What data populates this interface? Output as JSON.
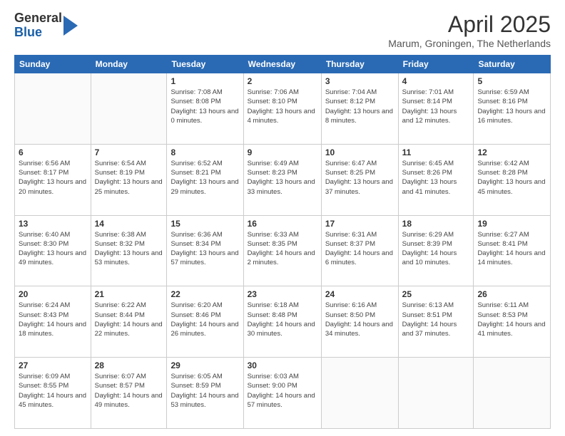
{
  "logo": {
    "general": "General",
    "blue": "Blue"
  },
  "header": {
    "month": "April 2025",
    "location": "Marum, Groningen, The Netherlands"
  },
  "weekdays": [
    "Sunday",
    "Monday",
    "Tuesday",
    "Wednesday",
    "Thursday",
    "Friday",
    "Saturday"
  ],
  "weeks": [
    [
      {
        "day": "",
        "info": ""
      },
      {
        "day": "",
        "info": ""
      },
      {
        "day": "1",
        "info": "Sunrise: 7:08 AM\nSunset: 8:08 PM\nDaylight: 13 hours and 0 minutes."
      },
      {
        "day": "2",
        "info": "Sunrise: 7:06 AM\nSunset: 8:10 PM\nDaylight: 13 hours and 4 minutes."
      },
      {
        "day": "3",
        "info": "Sunrise: 7:04 AM\nSunset: 8:12 PM\nDaylight: 13 hours and 8 minutes."
      },
      {
        "day": "4",
        "info": "Sunrise: 7:01 AM\nSunset: 8:14 PM\nDaylight: 13 hours and 12 minutes."
      },
      {
        "day": "5",
        "info": "Sunrise: 6:59 AM\nSunset: 8:16 PM\nDaylight: 13 hours and 16 minutes."
      }
    ],
    [
      {
        "day": "6",
        "info": "Sunrise: 6:56 AM\nSunset: 8:17 PM\nDaylight: 13 hours and 20 minutes."
      },
      {
        "day": "7",
        "info": "Sunrise: 6:54 AM\nSunset: 8:19 PM\nDaylight: 13 hours and 25 minutes."
      },
      {
        "day": "8",
        "info": "Sunrise: 6:52 AM\nSunset: 8:21 PM\nDaylight: 13 hours and 29 minutes."
      },
      {
        "day": "9",
        "info": "Sunrise: 6:49 AM\nSunset: 8:23 PM\nDaylight: 13 hours and 33 minutes."
      },
      {
        "day": "10",
        "info": "Sunrise: 6:47 AM\nSunset: 8:25 PM\nDaylight: 13 hours and 37 minutes."
      },
      {
        "day": "11",
        "info": "Sunrise: 6:45 AM\nSunset: 8:26 PM\nDaylight: 13 hours and 41 minutes."
      },
      {
        "day": "12",
        "info": "Sunrise: 6:42 AM\nSunset: 8:28 PM\nDaylight: 13 hours and 45 minutes."
      }
    ],
    [
      {
        "day": "13",
        "info": "Sunrise: 6:40 AM\nSunset: 8:30 PM\nDaylight: 13 hours and 49 minutes."
      },
      {
        "day": "14",
        "info": "Sunrise: 6:38 AM\nSunset: 8:32 PM\nDaylight: 13 hours and 53 minutes."
      },
      {
        "day": "15",
        "info": "Sunrise: 6:36 AM\nSunset: 8:34 PM\nDaylight: 13 hours and 57 minutes."
      },
      {
        "day": "16",
        "info": "Sunrise: 6:33 AM\nSunset: 8:35 PM\nDaylight: 14 hours and 2 minutes."
      },
      {
        "day": "17",
        "info": "Sunrise: 6:31 AM\nSunset: 8:37 PM\nDaylight: 14 hours and 6 minutes."
      },
      {
        "day": "18",
        "info": "Sunrise: 6:29 AM\nSunset: 8:39 PM\nDaylight: 14 hours and 10 minutes."
      },
      {
        "day": "19",
        "info": "Sunrise: 6:27 AM\nSunset: 8:41 PM\nDaylight: 14 hours and 14 minutes."
      }
    ],
    [
      {
        "day": "20",
        "info": "Sunrise: 6:24 AM\nSunset: 8:43 PM\nDaylight: 14 hours and 18 minutes."
      },
      {
        "day": "21",
        "info": "Sunrise: 6:22 AM\nSunset: 8:44 PM\nDaylight: 14 hours and 22 minutes."
      },
      {
        "day": "22",
        "info": "Sunrise: 6:20 AM\nSunset: 8:46 PM\nDaylight: 14 hours and 26 minutes."
      },
      {
        "day": "23",
        "info": "Sunrise: 6:18 AM\nSunset: 8:48 PM\nDaylight: 14 hours and 30 minutes."
      },
      {
        "day": "24",
        "info": "Sunrise: 6:16 AM\nSunset: 8:50 PM\nDaylight: 14 hours and 34 minutes."
      },
      {
        "day": "25",
        "info": "Sunrise: 6:13 AM\nSunset: 8:51 PM\nDaylight: 14 hours and 37 minutes."
      },
      {
        "day": "26",
        "info": "Sunrise: 6:11 AM\nSunset: 8:53 PM\nDaylight: 14 hours and 41 minutes."
      }
    ],
    [
      {
        "day": "27",
        "info": "Sunrise: 6:09 AM\nSunset: 8:55 PM\nDaylight: 14 hours and 45 minutes."
      },
      {
        "day": "28",
        "info": "Sunrise: 6:07 AM\nSunset: 8:57 PM\nDaylight: 14 hours and 49 minutes."
      },
      {
        "day": "29",
        "info": "Sunrise: 6:05 AM\nSunset: 8:59 PM\nDaylight: 14 hours and 53 minutes."
      },
      {
        "day": "30",
        "info": "Sunrise: 6:03 AM\nSunset: 9:00 PM\nDaylight: 14 hours and 57 minutes."
      },
      {
        "day": "",
        "info": ""
      },
      {
        "day": "",
        "info": ""
      },
      {
        "day": "",
        "info": ""
      }
    ]
  ]
}
